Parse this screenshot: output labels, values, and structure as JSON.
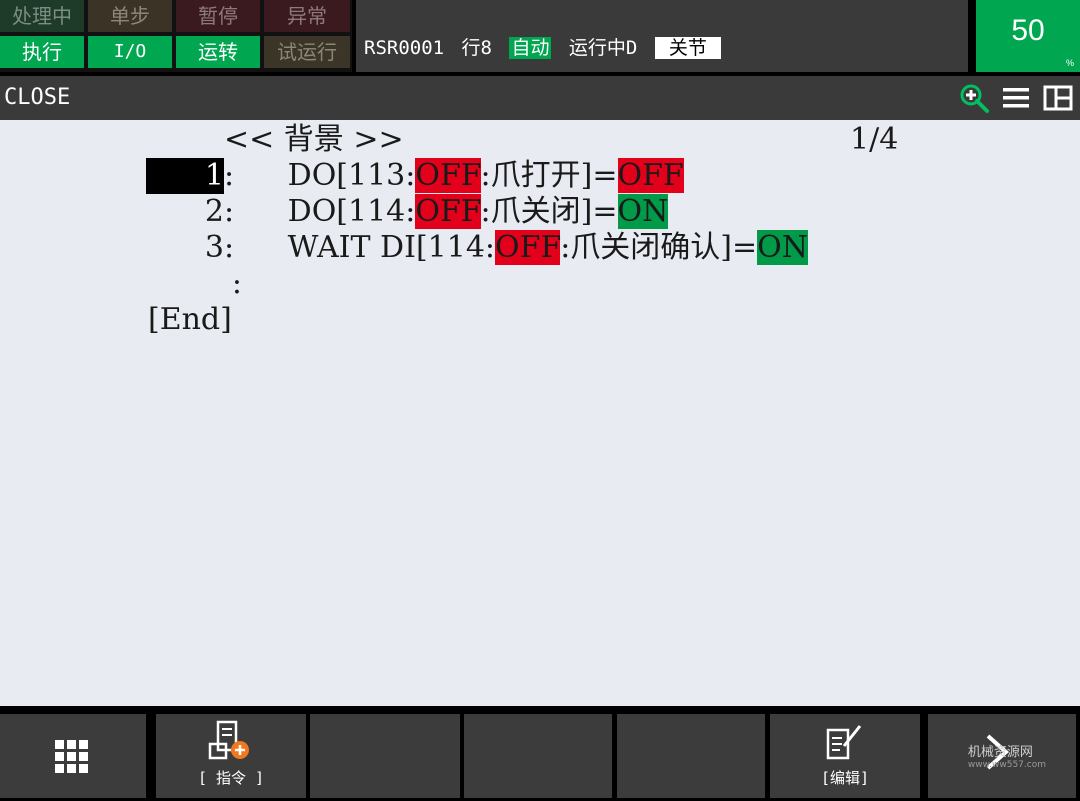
{
  "status_lamps": {
    "row1": [
      "处理中",
      "单步",
      "暂停",
      "异常"
    ],
    "row2": [
      "执行",
      "I/O",
      "运转",
      "试运行"
    ]
  },
  "status_line": {
    "program": "RSR0001",
    "line": "行8",
    "mode": "自动",
    "state": "运行中D",
    "coord": "关节"
  },
  "override": {
    "value": "50",
    "unit": "%"
  },
  "titlebar": {
    "program_name": "CLOSE",
    "icons": [
      "zoom-in-icon",
      "menu-icon",
      "split-view-icon"
    ]
  },
  "program": {
    "header": "<< 背景 >>",
    "page": "1/4",
    "lines": [
      {
        "num": "1",
        "parts": [
          "DO[113:",
          "OFF",
          ":爪打开]=",
          "OFF"
        ]
      },
      {
        "num": "2",
        "parts": [
          "DO[114:",
          "OFF",
          ":爪关闭]=",
          "ON"
        ]
      },
      {
        "num": "3",
        "parts": [
          "WAIT DI[114:",
          "OFF",
          ":爪关闭确认]=",
          "ON"
        ]
      }
    ],
    "ellipsis": ":",
    "end": "[End]"
  },
  "function_keys": {
    "f1": "",
    "f2": "[ 指令 ]",
    "f3": "",
    "f4": "",
    "f5": "",
    "f6": "[编辑]",
    "f7": ""
  },
  "watermark": {
    "line1": "机械资源网",
    "line2": "www.ww557.com"
  },
  "colors": {
    "lamp_on": "#00a650",
    "io_off": "#e3001b",
    "io_on": "#009a49",
    "content_bg": "#e8ecf2",
    "bar_bg": "#3a3a3a"
  }
}
